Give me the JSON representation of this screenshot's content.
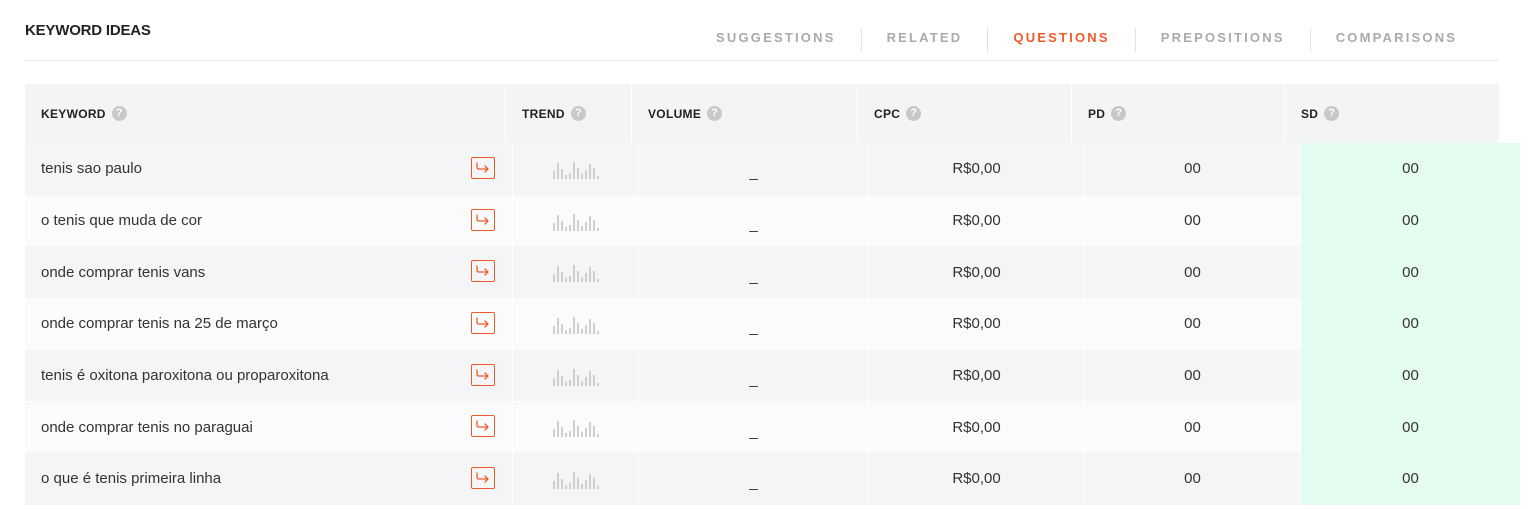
{
  "header": {
    "title": "KEYWORD IDEAS",
    "tabs": [
      {
        "label": "SUGGESTIONS",
        "active": false
      },
      {
        "label": "RELATED",
        "active": false
      },
      {
        "label": "QUESTIONS",
        "active": true
      },
      {
        "label": "PREPOSITIONS",
        "active": false
      },
      {
        "label": "COMPARISONS",
        "active": false
      }
    ]
  },
  "table": {
    "columns": [
      "KEYWORD",
      "TREND",
      "VOLUME",
      "CPC",
      "PD",
      "SD"
    ],
    "help_glyph": "?",
    "rows": [
      {
        "keyword": "tenis sao paulo",
        "volume": "_",
        "cpc": "R$0,00",
        "pd": "00",
        "sd": "00"
      },
      {
        "keyword": "o tenis que muda de cor",
        "volume": "_",
        "cpc": "R$0,00",
        "pd": "00",
        "sd": "00"
      },
      {
        "keyword": "onde comprar tenis vans",
        "volume": "_",
        "cpc": "R$0,00",
        "pd": "00",
        "sd": "00"
      },
      {
        "keyword": "onde comprar tenis na 25 de março",
        "volume": "_",
        "cpc": "R$0,00",
        "pd": "00",
        "sd": "00"
      },
      {
        "keyword": "tenis é oxitona paroxitona ou proparoxitona",
        "volume": "_",
        "cpc": "R$0,00",
        "pd": "00",
        "sd": "00"
      },
      {
        "keyword": "onde comprar tenis no paraguai",
        "volume": "_",
        "cpc": "R$0,00",
        "pd": "00",
        "sd": "00"
      },
      {
        "keyword": "o que é tenis primeira linha",
        "volume": "_",
        "cpc": "R$0,00",
        "pd": "00",
        "sd": "00"
      }
    ]
  },
  "colors": {
    "accent": "#f05a28",
    "sd_background": "#e3fcef",
    "trend_bar": "#cfcfcf"
  },
  "icons": {
    "row_action": "arrow-right-icon",
    "trend": "trend-sparkline-icon",
    "help": "help-circle-icon"
  }
}
